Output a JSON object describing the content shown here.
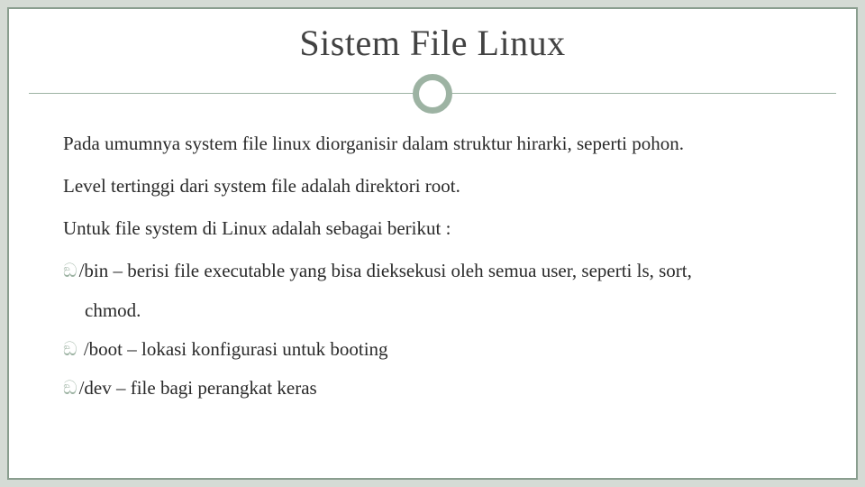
{
  "title": "Sistem File Linux",
  "paragraphs": {
    "p1": "Pada umumnya system file linux diorganisir dalam struktur hirarki, seperti pohon.",
    "p2": "Level tertinggi dari system file adalah direktori root.",
    "p3": "Untuk file system di Linux adalah sebagai berikut :"
  },
  "bullets": {
    "b1": "/bin – berisi file executable yang bisa dieksekusi oleh semua user, seperti ls, sort,",
    "b1_cont": "chmod.",
    "b2": " /boot – lokasi konfigurasi untuk booting",
    "b3": "/dev – file bagi perangkat keras"
  },
  "bullet_glyph": "ඞ"
}
